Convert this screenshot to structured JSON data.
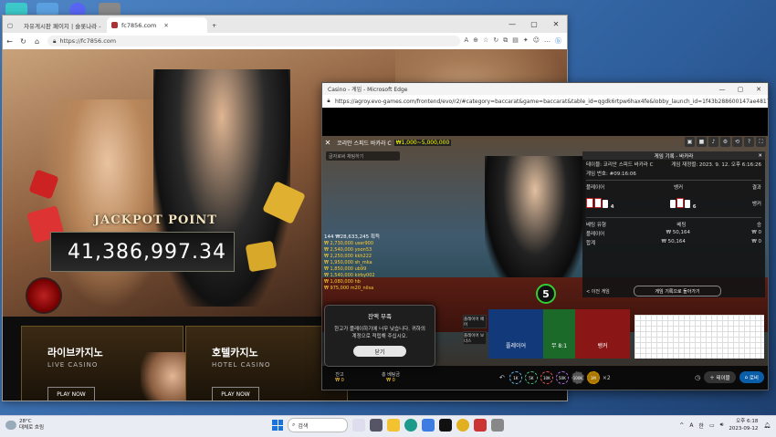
{
  "browser1": {
    "tabs": [
      {
        "title": "자유게시판 페이지 | 슬롯나라 -"
      },
      {
        "title": "fc7856.com"
      }
    ],
    "url": "https://fc7856.com",
    "jackpot_label": "JACKPOT POINT",
    "jackpot_value": "41,386,997.34",
    "banners": [
      {
        "title": "라이브카지노",
        "subtitle": "LIVE CASINO",
        "cta": "PLAY NOW"
      },
      {
        "title": "호텔카지노",
        "subtitle": "HOTEL CASINO",
        "cta": "PLAY NOW"
      }
    ]
  },
  "browser2": {
    "title": "Casino - 게임 - Microsoft Edge",
    "url": "https://agroy.evo-games.com/frontend/evo/r2/#category=baccarat&game=baccarat&table_id=qgdk6rtpw6hax4fe&lobby_launch_id=1f43b288600147ae4817007...",
    "game": {
      "table_name": "코리안 스피드 바카라 C",
      "limit": "₩1,000~5,000,000",
      "chat_placeholder": "글자로써 채팅하기",
      "bets_header": "144  ₩28,633,245  획득",
      "bets": [
        "₩ 2,730,000  user900",
        "₩ 2,540,000  yoon53",
        "₩ 2,250,000  kkh222",
        "₩ 1,950,000  sh_mka",
        "₩ 1,850,000  ub99",
        "₩ 1,540,000  kirby002",
        "₩ 1,080,000  hb",
        "₩ 975,000  m20_nilsa"
      ],
      "history": {
        "title": "게임 기록 - 바카라",
        "table_line": "테이블: 코리안 스피드 바카라 C",
        "game_no": "게임 번호: #09:16:06",
        "date_line": "게임 재정렬: 2023. 9. 12. 오후 6:16:26",
        "player_label": "플레이어",
        "banker_label": "뱅커",
        "result_label": "결과",
        "player_score": "4",
        "banker_score": "6",
        "result_value": "뱅커",
        "col_bet_type": "베팅 유형",
        "col_bet": "베팅",
        "col_win": "승",
        "rows": [
          {
            "type": "플레이어",
            "bet": "₩ 50,164",
            "win": "₩ 0"
          },
          {
            "type": "합계",
            "bet": "₩ 50,164",
            "win": "₩ 0"
          }
        ],
        "prev": "< 이전 게임",
        "back": "게임 기록으로 돌아가기"
      },
      "result_number": "5",
      "bet_player": "플레이어",
      "bet_tie": "무 8:1",
      "bet_banker": "뱅커",
      "side_bets": [
        "플레이어 페어",
        "플레이어 보너스",
        "뱅커 페어",
        "뱅커 보너스"
      ],
      "balance_label": "잔고",
      "balance_value": "₩ 0",
      "total_bet_label": "총 베팅금",
      "total_bet_value": "₩ 0",
      "chips": [
        "1K",
        "5K",
        "10K",
        "50K",
        "100K",
        "1M"
      ],
      "btn_table": "테이블",
      "btn_lobby": "로비",
      "dialog": {
        "title": "잔액 부족",
        "body": "한고가 플레이하기에 너무 낮습니다. 귀하의 계정으로 적립해 주십시오.",
        "button": "닫기"
      }
    }
  },
  "taskbar": {
    "weather_temp": "28°C",
    "weather_desc": "대체로 흐림",
    "search_label": "검색",
    "lang": "A",
    "ime": "한",
    "time": "오후 6:18",
    "date": "2023-09-12"
  }
}
